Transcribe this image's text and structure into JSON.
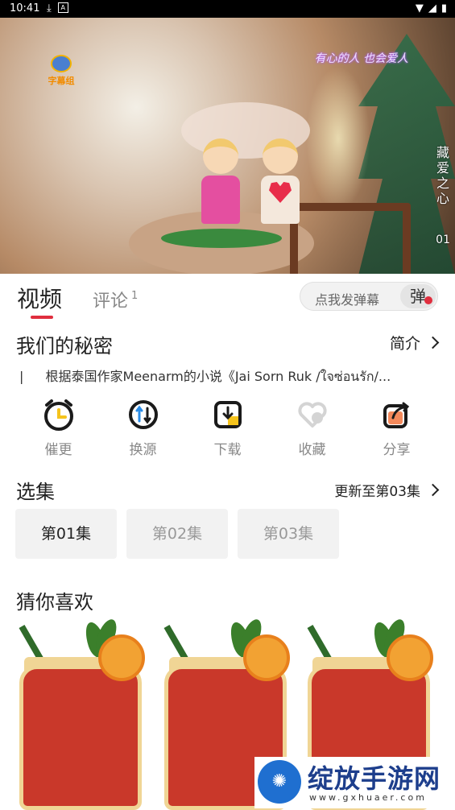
{
  "status_bar": {
    "time": "10:41",
    "icons": [
      "download-icon",
      "notification-icon",
      "wifi-icon",
      "signal-icon",
      "battery-icon"
    ]
  },
  "player": {
    "logo_text": "字幕组",
    "overlay_text": "有心的人 也会爱人",
    "side_title": "藏爱之心",
    "episode_label": "01"
  },
  "tabs": {
    "video": "视频",
    "comment": "评论",
    "comment_count": "1"
  },
  "danmaku": {
    "placeholder": "点我发弹幕",
    "button": "弹"
  },
  "show": {
    "title": "我们的秘密",
    "intro_label": "简介",
    "description": "根据泰国作家Meenarm的小说《Jai Sorn Ruk /ใจซ่อนรัก/..."
  },
  "actions": [
    {
      "label": "催更",
      "icon": "alarm-clock-icon"
    },
    {
      "label": "换源",
      "icon": "switch-source-icon"
    },
    {
      "label": "下载",
      "icon": "download-icon"
    },
    {
      "label": "收藏",
      "icon": "heart-icon"
    },
    {
      "label": "分享",
      "icon": "share-icon"
    }
  ],
  "episodes": {
    "title": "选集",
    "update_text": "更新至第03集",
    "items": [
      "第01集",
      "第02集",
      "第03集"
    ],
    "selected": 0
  },
  "recommend": {
    "title": "猜你喜欢"
  },
  "watermark": {
    "name": "绽放手游网",
    "url": "www.gxhuaer.com"
  },
  "colors": {
    "accent": "#e02e3e",
    "orange": "#f28c00",
    "text": "#222222",
    "muted": "#888888"
  }
}
